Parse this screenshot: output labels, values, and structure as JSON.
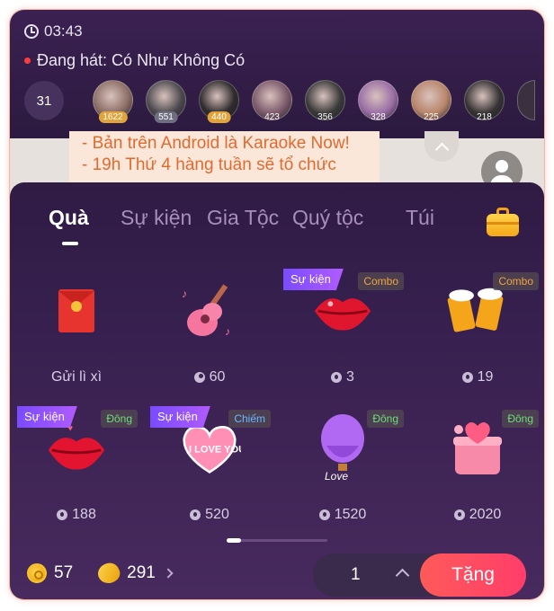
{
  "header": {
    "timer": "03:43",
    "now_singing": "Đang hát: Có Như Không Có",
    "viewer_count": "31",
    "avatars": [
      {
        "badge": "1622",
        "badge_color": "#e0a43b",
        "color": "#8c6f66"
      },
      {
        "badge": "551",
        "badge_color": "#6e6e80",
        "color": "#4d4a4f"
      },
      {
        "badge": "440",
        "badge_color": "#e0a43b",
        "color": "#2f2b2d"
      },
      {
        "badge": "423",
        "badge_color": "",
        "color": "#7b5a6b"
      },
      {
        "badge": "356",
        "badge_color": "",
        "color": "#3a3a3a"
      },
      {
        "badge": "328",
        "badge_color": "",
        "color": "#9a6fa5"
      },
      {
        "badge": "225",
        "badge_color": "",
        "color": "#b8866b"
      },
      {
        "badge": "218",
        "badge_color": "",
        "color": "#363334"
      }
    ]
  },
  "chat": {
    "message": "- Bản trên Android là Karaoke Now!\n- 19h Thứ 4 hàng tuần sẽ tổ chức"
  },
  "tabs": [
    "Quà",
    "Sự kiện",
    "Gia Tộc",
    "Quý tộc",
    "Túi"
  ],
  "active_tab": "Quà",
  "gifts": [
    {
      "name": "Gửi lì xì",
      "price": "",
      "currency": "",
      "event_tag": "",
      "kind_tag": "",
      "kind_color": "",
      "icon": "red-envelope-icon"
    },
    {
      "name": "",
      "price": "60",
      "currency": "bean",
      "event_tag": "",
      "kind_tag": "",
      "kind_color": "",
      "icon": "guitar-icon"
    },
    {
      "name": "",
      "price": "3",
      "currency": "coin",
      "event_tag": "Sự kiện",
      "kind_tag": "Combo",
      "kind_color": "#f0a442",
      "icon": "lips-icon"
    },
    {
      "name": "",
      "price": "19",
      "currency": "coin",
      "event_tag": "",
      "kind_tag": "Combo",
      "kind_color": "#f0a442",
      "icon": "beer-icon"
    },
    {
      "name": "",
      "price": "188",
      "currency": "coin",
      "event_tag": "Sự kiện",
      "kind_tag": "Đông",
      "kind_color": "#6fdc7a",
      "icon": "kiss-icon"
    },
    {
      "name": "",
      "price": "520",
      "currency": "coin",
      "event_tag": "Sự kiện",
      "kind_tag": "Chiếm",
      "kind_color": "#6ab8ff",
      "icon": "i-love-you-heart-icon"
    },
    {
      "name": "",
      "price": "1520",
      "currency": "coin",
      "event_tag": "",
      "kind_tag": "Đông",
      "kind_color": "#6fdc7a",
      "icon": "hot-air-balloon-icon"
    },
    {
      "name": "",
      "price": "2020",
      "currency": "coin",
      "event_tag": "",
      "kind_tag": "Đông",
      "kind_color": "#6fdc7a",
      "icon": "heart-box-icon"
    }
  ],
  "wallet": {
    "coins": "57",
    "beans": "291"
  },
  "quantity": "1",
  "send_label": "Tặng"
}
